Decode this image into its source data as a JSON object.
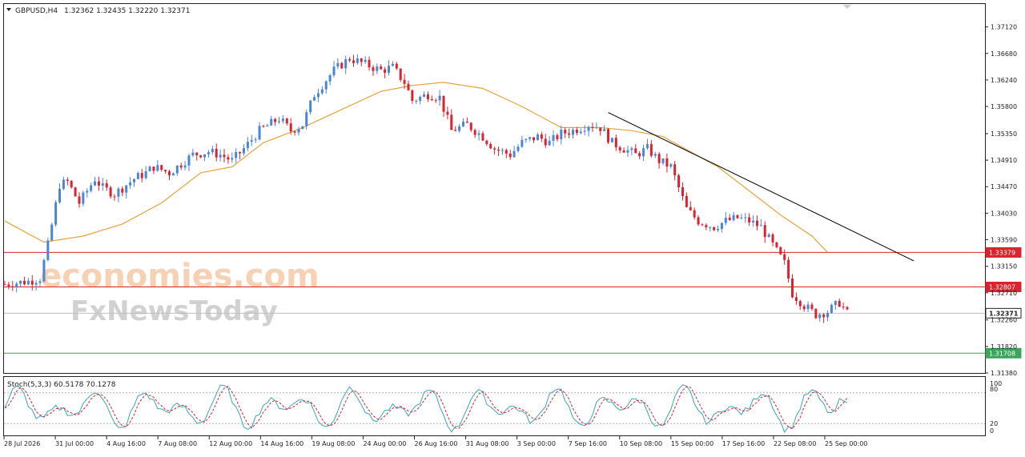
{
  "header": {
    "symbol": "GBPUSD,H4",
    "ohlc": "1.32362 1.32435 1.32220 1.32371",
    "menu_icon": "triangle-down-icon"
  },
  "watermark": {
    "line1": "economies.com",
    "line2": "FxNewsToday"
  },
  "oscillator": {
    "title": "Stoch(5,3,3) 60.5178 70.1278",
    "levels": [
      "100",
      "80",
      "20",
      "0"
    ]
  },
  "price_axis": {
    "ticks": [
      "1.37120",
      "1.36680",
      "1.36240",
      "1.35800",
      "1.35350",
      "1.34910",
      "1.34470",
      "1.34030",
      "1.33590",
      "1.33150",
      "1.32710",
      "1.32260",
      "1.31820",
      "1.31380"
    ]
  },
  "time_axis": {
    "labels": [
      "28 Jul 2026",
      "31 Jul 00:00",
      "4 Aug 16:00",
      "7 Aug 08:00",
      "12 Aug 00:00",
      "14 Aug 16:00",
      "19 Aug 08:00",
      "24 Aug 00:00",
      "26 Aug 16:00",
      "31 Aug 08:00",
      "3 Sep 00:00",
      "7 Sep 16:00",
      "10 Sep 08:00",
      "15 Sep 00:00",
      "17 Sep 16:00",
      "22 Sep 08:00",
      "25 Sep 00:00"
    ]
  },
  "colors": {
    "bull": "#4a86d6",
    "bear": "#d9232e",
    "ma": "#e8a33a",
    "resistance": "#d9232e",
    "support": "#3aa55c",
    "current": "#bfbfbf",
    "stoch_main": "#3aa6b9",
    "stoch_signal": "#d9232e"
  },
  "chart_data": {
    "type": "candlestick",
    "symbol": "GBPUSD",
    "timeframe": "H4",
    "ylim": [
      1.3138,
      1.375
    ],
    "price_levels": [
      {
        "value": 1.33379,
        "label": "1.33379",
        "color": "#d9232e"
      },
      {
        "value": 1.32807,
        "label": "1.32807",
        "color": "#d9232e"
      },
      {
        "value": 1.32371,
        "label": "1.32371",
        "color": "#222222"
      },
      {
        "value": 1.31708,
        "label": "1.31708",
        "color": "#3aa55c"
      }
    ],
    "close_path": [
      [
        0,
        1.3285
      ],
      [
        6,
        1.329
      ],
      [
        9,
        1.3295
      ],
      [
        11,
        1.335
      ],
      [
        14,
        1.345
      ],
      [
        16,
        1.3455
      ],
      [
        19,
        1.342
      ],
      [
        23,
        1.346
      ],
      [
        25,
        1.3445
      ],
      [
        28,
        1.3435
      ],
      [
        33,
        1.346
      ],
      [
        36,
        1.347
      ],
      [
        38,
        1.348
      ],
      [
        42,
        1.347
      ],
      [
        48,
        1.35
      ],
      [
        52,
        1.3505
      ],
      [
        55,
        1.35
      ],
      [
        58,
        1.349
      ],
      [
        61,
        1.351
      ],
      [
        65,
        1.354
      ],
      [
        70,
        1.356
      ],
      [
        73,
        1.354
      ],
      [
        76,
        1.355
      ],
      [
        79,
        1.36
      ],
      [
        84,
        1.364
      ],
      [
        88,
        1.366
      ],
      [
        92,
        1.365
      ],
      [
        96,
        1.364
      ],
      [
        99,
        1.3645
      ],
      [
        102,
        1.362
      ],
      [
        104,
        1.359
      ],
      [
        108,
        1.36
      ],
      [
        111,
        1.3595
      ],
      [
        114,
        1.354
      ],
      [
        118,
        1.355
      ],
      [
        122,
        1.353
      ],
      [
        125,
        1.351
      ],
      [
        129,
        1.35
      ],
      [
        132,
        1.352
      ],
      [
        136,
        1.353
      ],
      [
        139,
        1.352
      ],
      [
        142,
        1.3535
      ],
      [
        145,
        1.354
      ],
      [
        149,
        1.355
      ],
      [
        152,
        1.3545
      ],
      [
        155,
        1.352
      ],
      [
        158,
        1.351
      ],
      [
        161,
        1.35
      ],
      [
        164,
        1.351
      ],
      [
        167,
        1.349
      ],
      [
        170,
        1.348
      ],
      [
        174,
        1.341
      ],
      [
        177,
        1.339
      ],
      [
        181,
        1.338
      ],
      [
        184,
        1.339
      ],
      [
        187,
        1.3395
      ],
      [
        190,
        1.339
      ],
      [
        193,
        1.338
      ],
      [
        196,
        1.335
      ],
      [
        199,
        1.332
      ],
      [
        201,
        1.327
      ],
      [
        204,
        1.325
      ],
      [
        207,
        1.3235
      ],
      [
        210,
        1.324
      ],
      [
        213,
        1.3255
      ],
      [
        215,
        1.3237
      ]
    ],
    "moving_average": [
      [
        0,
        1.339
      ],
      [
        10,
        1.3355
      ],
      [
        20,
        1.3365
      ],
      [
        30,
        1.3385
      ],
      [
        40,
        1.342
      ],
      [
        50,
        1.347
      ],
      [
        58,
        1.348
      ],
      [
        66,
        1.352
      ],
      [
        76,
        1.3545
      ],
      [
        86,
        1.3575
      ],
      [
        96,
        1.3605
      ],
      [
        104,
        1.3615
      ],
      [
        112,
        1.362
      ],
      [
        122,
        1.361
      ],
      [
        132,
        1.358
      ],
      [
        142,
        1.3545
      ],
      [
        152,
        1.3545
      ],
      [
        160,
        1.354
      ],
      [
        168,
        1.353
      ],
      [
        175,
        1.3505
      ],
      [
        182,
        1.348
      ],
      [
        190,
        1.344
      ],
      [
        198,
        1.34
      ],
      [
        206,
        1.3365
      ],
      [
        210,
        1.3338
      ]
    ],
    "trendline": {
      "start": [
        154,
        1.357
      ],
      "end": [
        232,
        1.3324
      ]
    },
    "stochastic": {
      "main_last": 60.5178,
      "signal_last": 70.1278,
      "levels": [
        80,
        20
      ]
    }
  }
}
